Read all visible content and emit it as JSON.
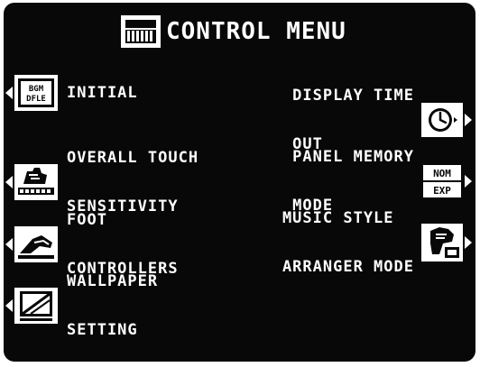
{
  "title": {
    "text": "CONTROL MENU",
    "icon": "keyboard-icon"
  },
  "left_items": [
    {
      "lines": [
        "INITIAL"
      ],
      "icon": "initial-icon",
      "icon_text": [
        "BGM",
        "DFLE"
      ]
    },
    {
      "lines": [
        "OVERALL TOUCH",
        "SENSITIVITY"
      ],
      "icon": "touch-hand-icon"
    },
    {
      "lines": [
        "FOOT",
        "CONTROLLERS"
      ],
      "icon": "foot-pedal-icon"
    },
    {
      "lines": [
        "WALLPAPER",
        "SETTING"
      ],
      "icon": "wallpaper-icon"
    }
  ],
  "right_items": [
    {
      "lines": [
        "DISPLAY TIME",
        "OUT"
      ],
      "icon": "clock-icon"
    },
    {
      "lines": [
        "PANEL MEMORY",
        "MODE"
      ],
      "icon": "nom-exp-icon",
      "icon_text": [
        "NOM",
        "EXP"
      ]
    },
    {
      "lines": [
        "MUSIC STYLE",
        "ARRANGER MODE"
      ],
      "icon": "arranger-hand-icon"
    }
  ]
}
